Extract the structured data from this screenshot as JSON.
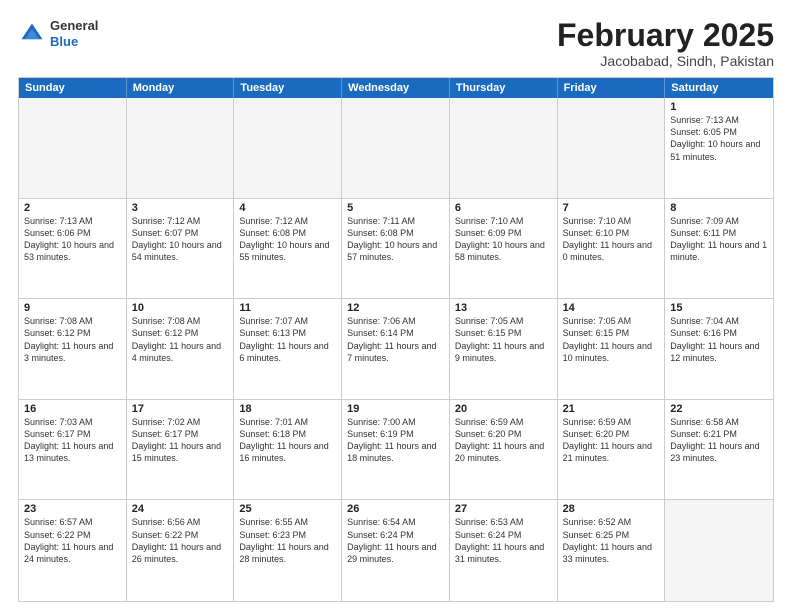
{
  "header": {
    "logo": {
      "general": "General",
      "blue": "Blue"
    },
    "title": "February 2025",
    "location": "Jacobabad, Sindh, Pakistan"
  },
  "calendar": {
    "days": [
      "Sunday",
      "Monday",
      "Tuesday",
      "Wednesday",
      "Thursday",
      "Friday",
      "Saturday"
    ],
    "weeks": [
      [
        {
          "day": "",
          "empty": true
        },
        {
          "day": "",
          "empty": true
        },
        {
          "day": "",
          "empty": true
        },
        {
          "day": "",
          "empty": true
        },
        {
          "day": "",
          "empty": true
        },
        {
          "day": "",
          "empty": true
        },
        {
          "day": "1",
          "sunrise": "Sunrise: 7:13 AM",
          "sunset": "Sunset: 6:05 PM",
          "daylight": "Daylight: 10 hours and 51 minutes."
        }
      ],
      [
        {
          "day": "2",
          "sunrise": "Sunrise: 7:13 AM",
          "sunset": "Sunset: 6:06 PM",
          "daylight": "Daylight: 10 hours and 53 minutes."
        },
        {
          "day": "3",
          "sunrise": "Sunrise: 7:12 AM",
          "sunset": "Sunset: 6:07 PM",
          "daylight": "Daylight: 10 hours and 54 minutes."
        },
        {
          "day": "4",
          "sunrise": "Sunrise: 7:12 AM",
          "sunset": "Sunset: 6:08 PM",
          "daylight": "Daylight: 10 hours and 55 minutes."
        },
        {
          "day": "5",
          "sunrise": "Sunrise: 7:11 AM",
          "sunset": "Sunset: 6:08 PM",
          "daylight": "Daylight: 10 hours and 57 minutes."
        },
        {
          "day": "6",
          "sunrise": "Sunrise: 7:10 AM",
          "sunset": "Sunset: 6:09 PM",
          "daylight": "Daylight: 10 hours and 58 minutes."
        },
        {
          "day": "7",
          "sunrise": "Sunrise: 7:10 AM",
          "sunset": "Sunset: 6:10 PM",
          "daylight": "Daylight: 11 hours and 0 minutes."
        },
        {
          "day": "8",
          "sunrise": "Sunrise: 7:09 AM",
          "sunset": "Sunset: 6:11 PM",
          "daylight": "Daylight: 11 hours and 1 minute."
        }
      ],
      [
        {
          "day": "9",
          "sunrise": "Sunrise: 7:08 AM",
          "sunset": "Sunset: 6:12 PM",
          "daylight": "Daylight: 11 hours and 3 minutes."
        },
        {
          "day": "10",
          "sunrise": "Sunrise: 7:08 AM",
          "sunset": "Sunset: 6:12 PM",
          "daylight": "Daylight: 11 hours and 4 minutes."
        },
        {
          "day": "11",
          "sunrise": "Sunrise: 7:07 AM",
          "sunset": "Sunset: 6:13 PM",
          "daylight": "Daylight: 11 hours and 6 minutes."
        },
        {
          "day": "12",
          "sunrise": "Sunrise: 7:06 AM",
          "sunset": "Sunset: 6:14 PM",
          "daylight": "Daylight: 11 hours and 7 minutes."
        },
        {
          "day": "13",
          "sunrise": "Sunrise: 7:05 AM",
          "sunset": "Sunset: 6:15 PM",
          "daylight": "Daylight: 11 hours and 9 minutes."
        },
        {
          "day": "14",
          "sunrise": "Sunrise: 7:05 AM",
          "sunset": "Sunset: 6:15 PM",
          "daylight": "Daylight: 11 hours and 10 minutes."
        },
        {
          "day": "15",
          "sunrise": "Sunrise: 7:04 AM",
          "sunset": "Sunset: 6:16 PM",
          "daylight": "Daylight: 11 hours and 12 minutes."
        }
      ],
      [
        {
          "day": "16",
          "sunrise": "Sunrise: 7:03 AM",
          "sunset": "Sunset: 6:17 PM",
          "daylight": "Daylight: 11 hours and 13 minutes."
        },
        {
          "day": "17",
          "sunrise": "Sunrise: 7:02 AM",
          "sunset": "Sunset: 6:17 PM",
          "daylight": "Daylight: 11 hours and 15 minutes."
        },
        {
          "day": "18",
          "sunrise": "Sunrise: 7:01 AM",
          "sunset": "Sunset: 6:18 PM",
          "daylight": "Daylight: 11 hours and 16 minutes."
        },
        {
          "day": "19",
          "sunrise": "Sunrise: 7:00 AM",
          "sunset": "Sunset: 6:19 PM",
          "daylight": "Daylight: 11 hours and 18 minutes."
        },
        {
          "day": "20",
          "sunrise": "Sunrise: 6:59 AM",
          "sunset": "Sunset: 6:20 PM",
          "daylight": "Daylight: 11 hours and 20 minutes."
        },
        {
          "day": "21",
          "sunrise": "Sunrise: 6:59 AM",
          "sunset": "Sunset: 6:20 PM",
          "daylight": "Daylight: 11 hours and 21 minutes."
        },
        {
          "day": "22",
          "sunrise": "Sunrise: 6:58 AM",
          "sunset": "Sunset: 6:21 PM",
          "daylight": "Daylight: 11 hours and 23 minutes."
        }
      ],
      [
        {
          "day": "23",
          "sunrise": "Sunrise: 6:57 AM",
          "sunset": "Sunset: 6:22 PM",
          "daylight": "Daylight: 11 hours and 24 minutes."
        },
        {
          "day": "24",
          "sunrise": "Sunrise: 6:56 AM",
          "sunset": "Sunset: 6:22 PM",
          "daylight": "Daylight: 11 hours and 26 minutes."
        },
        {
          "day": "25",
          "sunrise": "Sunrise: 6:55 AM",
          "sunset": "Sunset: 6:23 PM",
          "daylight": "Daylight: 11 hours and 28 minutes."
        },
        {
          "day": "26",
          "sunrise": "Sunrise: 6:54 AM",
          "sunset": "Sunset: 6:24 PM",
          "daylight": "Daylight: 11 hours and 29 minutes."
        },
        {
          "day": "27",
          "sunrise": "Sunrise: 6:53 AM",
          "sunset": "Sunset: 6:24 PM",
          "daylight": "Daylight: 11 hours and 31 minutes."
        },
        {
          "day": "28",
          "sunrise": "Sunrise: 6:52 AM",
          "sunset": "Sunset: 6:25 PM",
          "daylight": "Daylight: 11 hours and 33 minutes."
        },
        {
          "day": "",
          "empty": true
        }
      ]
    ]
  }
}
